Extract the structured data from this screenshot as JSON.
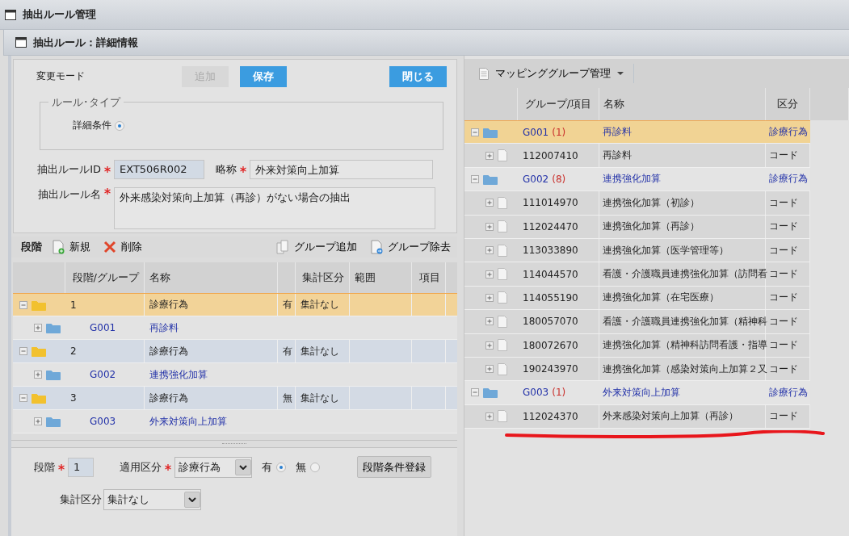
{
  "window": {
    "title": "抽出ルール管理"
  },
  "panel": {
    "title": "抽出ルール：詳細情報"
  },
  "form": {
    "mode_label": "変更モード",
    "actions": [
      {
        "label": "追加",
        "kind": "plain",
        "disabled": true
      },
      {
        "label": "保存",
        "kind": "primary",
        "disabled": false
      }
    ],
    "close_button": {
      "label": "閉じる",
      "kind": "primary",
      "disabled": false
    },
    "rule_type": {
      "legend": "ルール･タイプ",
      "options": [
        {
          "label": "詳細条件",
          "selected": true
        }
      ]
    },
    "fields": [
      {
        "label": "抽出ルールID",
        "required": true,
        "value": "EXT506R002",
        "readonly": true
      },
      {
        "label": "略称",
        "required": true,
        "value": "外来対策向上加算",
        "readonly": false
      }
    ],
    "rule_name": {
      "label": "抽出ルール名",
      "required": true,
      "value": "外来感染対策向上加算（再診）がない場合の抽出"
    }
  },
  "stages": {
    "title": "段階",
    "tools": [
      {
        "label": "新規",
        "kind": "new"
      },
      {
        "label": "削除",
        "kind": "delete"
      },
      {
        "label": "グループ追加",
        "kind": "group-add"
      },
      {
        "label": "グループ除去",
        "kind": "group-remove"
      }
    ],
    "columns": [
      "段階/グループ",
      "名称",
      "集計区分",
      "範囲",
      "項目"
    ],
    "rows": [
      {
        "number": "1",
        "name": "診療行為",
        "flag": "有",
        "aggregation": "集計なし",
        "selected": true,
        "expanded": true,
        "children": [
          {
            "code": "G001",
            "name": "再診料",
            "expanded": false
          }
        ]
      },
      {
        "number": "2",
        "name": "診療行為",
        "flag": "有",
        "aggregation": "集計なし",
        "selected": false,
        "expanded": true,
        "children": [
          {
            "code": "G002",
            "name": "連携強化加算",
            "expanded": false
          }
        ]
      },
      {
        "number": "3",
        "name": "診療行為",
        "flag": "無",
        "aggregation": "集計なし",
        "selected": false,
        "expanded": true,
        "children": [
          {
            "code": "G003",
            "name": "外来対策向上加算",
            "expanded": false
          }
        ]
      }
    ]
  },
  "stage_form": {
    "stage": {
      "label": "段階",
      "required": true,
      "value": "1"
    },
    "apply": {
      "label": "適用区分",
      "required": true,
      "value": "診療行為"
    },
    "flags": [
      {
        "label": "有",
        "selected": true
      },
      {
        "label": "無",
        "selected": false
      }
    ],
    "register_button": "段階条件登録",
    "aggregation": {
      "label": "集計区分",
      "value": "集計なし"
    }
  },
  "mapping": {
    "title": "マッピンググループ管理",
    "columns": [
      "グループ/項目",
      "名称",
      "区分"
    ],
    "groups": [
      {
        "code": "G001",
        "count": "(1)",
        "name": "再診料",
        "category": "診療行為",
        "selected": true,
        "expanded": true,
        "children": [
          {
            "code": "112007410",
            "name": "再診料",
            "category": "コード",
            "expanded": false
          }
        ]
      },
      {
        "code": "G002",
        "count": "(8)",
        "name": "連携強化加算",
        "category": "診療行為",
        "selected": false,
        "expanded": true,
        "children": [
          {
            "code": "111014970",
            "name": "連携強化加算（初診）",
            "category": "コード",
            "expanded": false
          },
          {
            "code": "112024470",
            "name": "連携強化加算（再診）",
            "category": "コード",
            "expanded": false
          },
          {
            "code": "113033890",
            "name": "連携強化加算（医学管理等）",
            "category": "コード",
            "expanded": false
          },
          {
            "code": "114044570",
            "name": "看護・介護職員連携強化加算（訪問看",
            "category": "コード",
            "expanded": false
          },
          {
            "code": "114055190",
            "name": "連携強化加算（在宅医療）",
            "category": "コード",
            "expanded": false
          },
          {
            "code": "180057070",
            "name": "看護・介護職員連携強化加算（精神科",
            "category": "コード",
            "expanded": false
          },
          {
            "code": "180072670",
            "name": "連携強化加算（精神科訪問看護・指導",
            "category": "コード",
            "expanded": false
          },
          {
            "code": "190243970",
            "name": "連携強化加算（感染対策向上加算２又",
            "category": "コード",
            "expanded": false
          }
        ]
      },
      {
        "code": "G003",
        "count": "(1)",
        "name": "外来対策向上加算",
        "category": "診療行為",
        "selected": false,
        "expanded": true,
        "children": [
          {
            "code": "112024370",
            "name": "外来感染対策向上加算（再診）",
            "category": "コード",
            "expanded": false
          }
        ]
      }
    ]
  }
}
